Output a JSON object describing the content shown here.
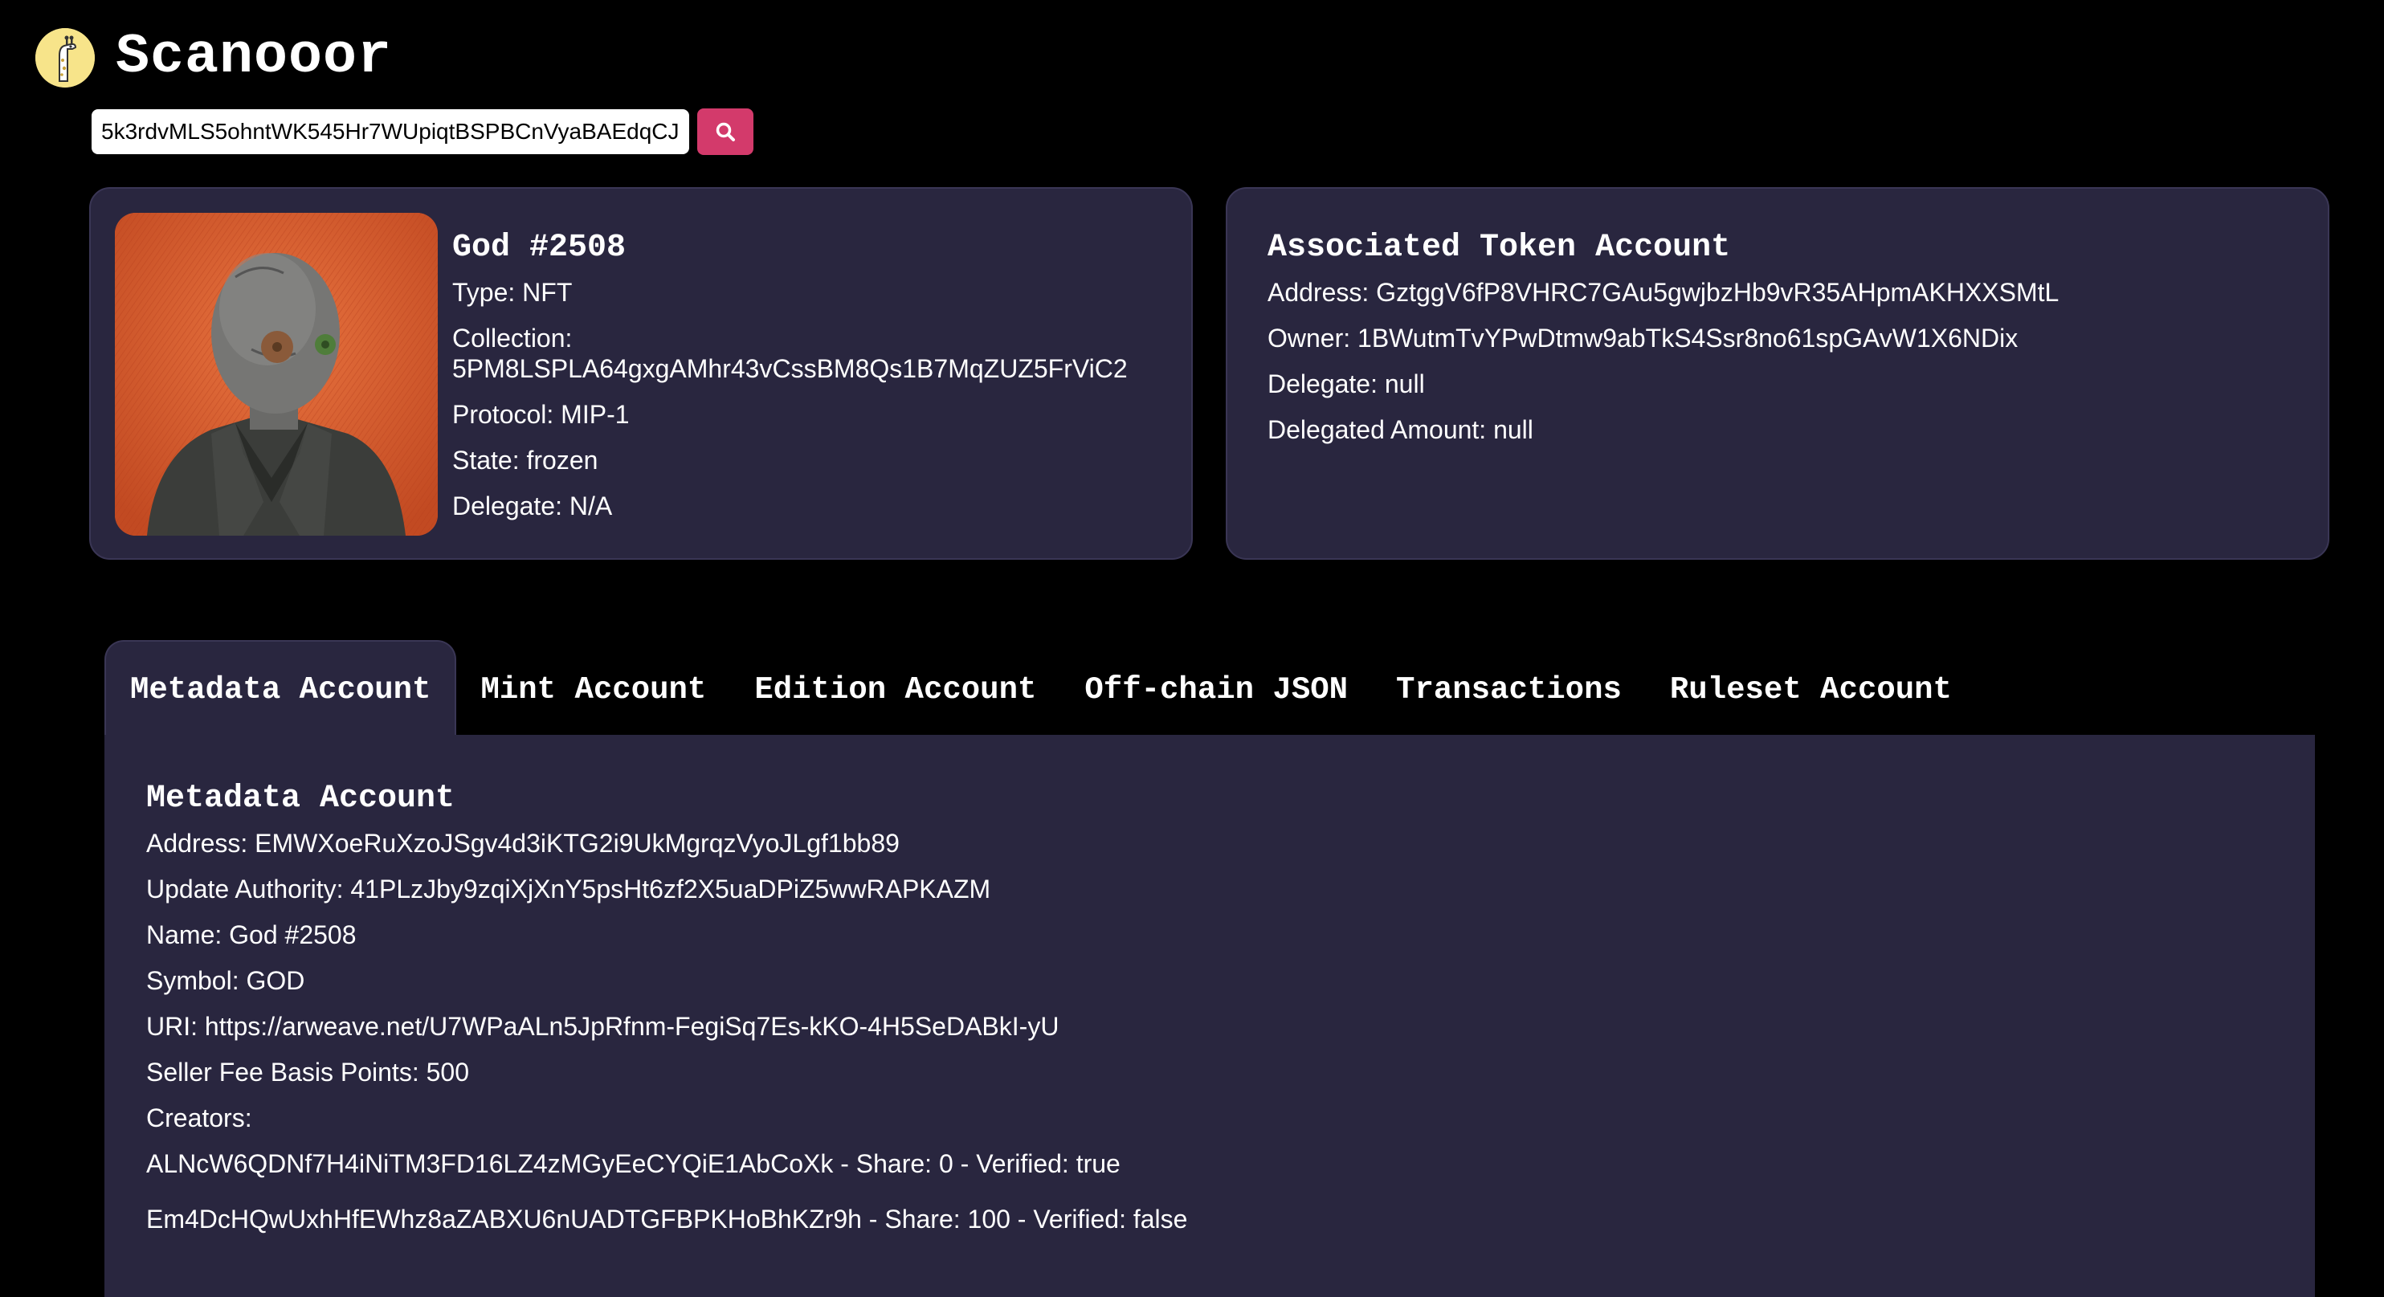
{
  "header": {
    "brand": "Scanooor",
    "logo_icon": "giraffe-logo-icon"
  },
  "search": {
    "value": "5k3rdvMLS5ohntWK545Hr7WUpiqtBSPBCnVyaBAEdqCJ",
    "button_icon": "search-icon"
  },
  "nft_card": {
    "title": "God #2508",
    "type": "Type: NFT",
    "collection": "Collection: 5PM8LSPLA64gxgAMhr43vCssBM8Qs1B7MqZUZ5FrViC2",
    "protocol": "Protocol: MIP-1",
    "state": "State: frozen",
    "delegate": "Delegate: N/A"
  },
  "ata_card": {
    "title": "Associated Token Account",
    "address": "Address: GztggV6fP8VHRC7GAu5gwjbzHb9vR35AHpmAKHXXSMtL",
    "owner": "Owner: 1BWutmTvYPwDtmw9abTkS4Ssr8no61spGAvW1X6NDix",
    "delegate": "Delegate: null",
    "delegated_amount": "Delegated Amount: null"
  },
  "tabs": [
    {
      "label": "Metadata Account",
      "active": true
    },
    {
      "label": "Mint Account",
      "active": false
    },
    {
      "label": "Edition Account",
      "active": false
    },
    {
      "label": "Off-chain JSON",
      "active": false
    },
    {
      "label": "Transactions",
      "active": false
    },
    {
      "label": "Ruleset Account",
      "active": false
    }
  ],
  "metadata": {
    "title": "Metadata Account",
    "address": "Address: EMWXoeRuXzoJSgv4d3iKTG2i9UkMgrqzVyoJLgf1bb89",
    "update_authority": "Update Authority: 41PLzJby9zqiXjXnY5psHt6zf2X5uaDPiZ5wwRAPKAZM",
    "name": "Name: God #2508",
    "symbol": "Symbol: GOD",
    "uri": "URI: https://arweave.net/U7WPaALn5JpRfnm-FegiSq7Es-kKO-4H5SeDABkI-yU",
    "seller_fee": "Seller Fee Basis Points: 500",
    "creators_label": "Creators:",
    "creators": [
      "ALNcW6QDNf7H4iNiTM3FD16LZ4zMGyEeCYQiE1AbCoXk - Share: 0 - Verified: true",
      "Em4DcHQwUxhHfEWhz8aZABXU6nUADTGFBPKHoBhKZr9h - Share: 100 - Verified: false"
    ]
  },
  "colors": {
    "background": "#000000",
    "card": "#29263f",
    "accent_button": "#d33a6b",
    "logo_bg": "#f7e48a"
  }
}
